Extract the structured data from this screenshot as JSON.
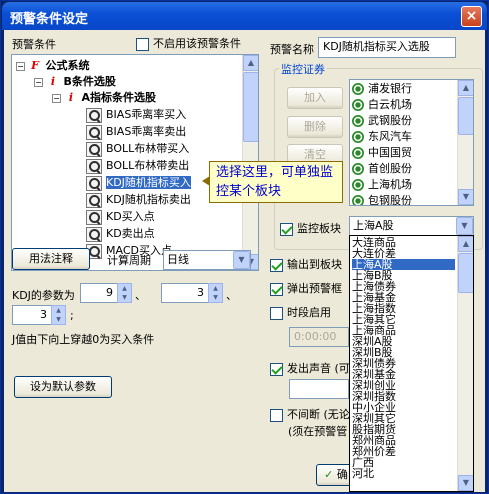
{
  "window": {
    "title": "预警条件设定",
    "close": "×"
  },
  "left": {
    "conditions_label": "预警条件",
    "disable_label": "不启用该预警条件",
    "tree": {
      "root": "公式系统",
      "level1": "B条件选股",
      "level2": "A指标条件选股",
      "items": [
        "BIAS乖离率买入",
        "BIAS乖离率卖出",
        "BOLL布林带买入",
        "BOLL布林带卖出",
        "KDJ随机指标买入",
        "KDJ随机指标卖出",
        "KD买入点",
        "KD卖出点",
        "MACD买入点"
      ],
      "selected_index": 4
    },
    "usage_button": "用法注释",
    "period_label": "计算周期",
    "period_value": "日线",
    "params_label": "KDJ的参数为",
    "params": [
      "9",
      "3",
      "3"
    ],
    "sep1": "、",
    "sep2": "、",
    "end_mark": ";",
    "desc": "J值由下向上穿越0为买入条件",
    "default_button": "设为默认参数"
  },
  "right": {
    "name_label": "预警名称",
    "name_value": "KDJ随机指标买入选股",
    "monitor_group": "监控证券",
    "add_button": "加入",
    "delete_button": "删除",
    "clear_button": "清空",
    "stocks": [
      "浦发银行",
      "白云机场",
      "武钢股份",
      "东风汽车",
      "中国国贸",
      "首创股份",
      "上海机场",
      "包钢股份"
    ],
    "monitor_block_label": "监控板块",
    "monitor_block_value": "上海A股",
    "output_block_label": "输出到板块",
    "popup_label": "弹出预警框",
    "time_enable_label": "时段启用",
    "time_value": "0:00:00",
    "sound_label": "发出声音 (可",
    "noninterrupt_label": "不间断 (无论",
    "noninterrupt_sub": "(须在预警管",
    "ok_button": "确",
    "tooltip": "选择这里，可单独监控某个板块"
  },
  "dropdown": {
    "items": [
      "大连商品",
      "大连价差",
      "上海A股",
      "上海B股",
      "上海债券",
      "上海基金",
      "上海指数",
      "上海其它",
      "上海商品",
      "深圳A股",
      "深圳B股",
      "深圳债券",
      "深圳基金",
      "深圳创业",
      "深圳指数",
      "中小企业",
      "深圳其它",
      "股指期货",
      "郑州商品",
      "郑州价差",
      "广西",
      "河北"
    ],
    "selected_index": 2
  }
}
